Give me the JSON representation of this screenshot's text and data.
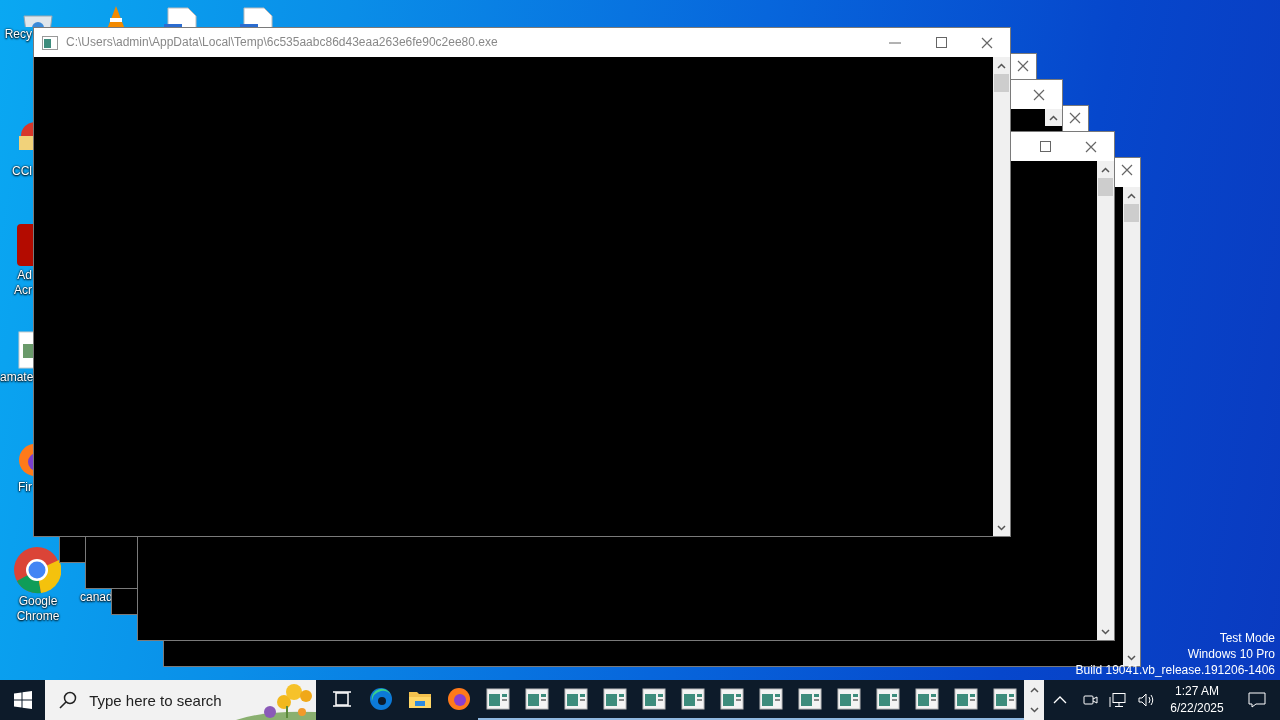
{
  "desktop": {
    "icons": [
      {
        "kind": "recycle-bin",
        "lines": [
          "Recy"
        ]
      },
      {
        "kind": "ccleaner",
        "lines": [
          "CCl"
        ]
      },
      {
        "kind": "acrobat",
        "lines": [
          "Ad",
          "Acr"
        ]
      },
      {
        "kind": "image-file",
        "lines": [
          "amate"
        ]
      },
      {
        "kind": "firefox",
        "lines": [
          "Fir"
        ]
      },
      {
        "kind": "chrome",
        "lines": [
          "Google",
          "Chrome"
        ]
      },
      {
        "kind": "blank",
        "lines": [
          "canad"
        ]
      }
    ],
    "top_icons": [
      {
        "kind": "vlc"
      },
      {
        "kind": "document"
      },
      {
        "kind": "document"
      }
    ],
    "watermark": [
      "Test Mode",
      "Windows 10 Pro",
      "Build 19041.vb_release.191206-1406"
    ]
  },
  "main_window": {
    "title": "C:\\Users\\admin\\AppData\\Local\\Temp\\6c535aabc86d43eaa263e6fe90c2ee80.exe"
  },
  "background_windows": [
    {
      "kind": "console"
    },
    {
      "kind": "console"
    },
    {
      "kind": "console"
    },
    {
      "kind": "console"
    },
    {
      "kind": "console"
    }
  ],
  "taskbar": {
    "search": {
      "placeholder": "Type here to search"
    },
    "pinned": [
      {
        "kind": "task-view"
      },
      {
        "kind": "edge"
      },
      {
        "kind": "explorer"
      },
      {
        "kind": "firefox"
      }
    ],
    "running": [
      {
        "kind": "console"
      },
      {
        "kind": "console"
      },
      {
        "kind": "console"
      },
      {
        "kind": "console"
      },
      {
        "kind": "console"
      },
      {
        "kind": "console"
      },
      {
        "kind": "console"
      },
      {
        "kind": "console"
      },
      {
        "kind": "console"
      },
      {
        "kind": "console"
      },
      {
        "kind": "console"
      },
      {
        "kind": "console"
      },
      {
        "kind": "console"
      },
      {
        "kind": "console"
      }
    ],
    "clock": {
      "time": "1:27 AM",
      "date": "6/22/2025"
    }
  }
}
